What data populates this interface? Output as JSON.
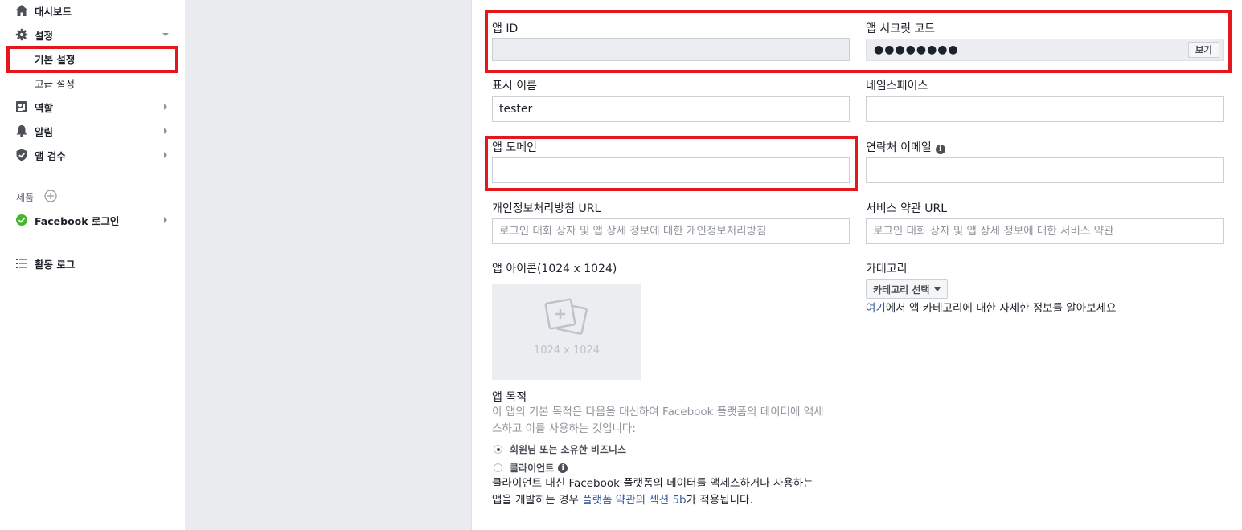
{
  "sidebar": {
    "items": [
      {
        "label": "대시보드",
        "icon": "home-icon"
      },
      {
        "label": "설정",
        "icon": "gear-icon"
      },
      {
        "label": "기본 설정"
      },
      {
        "label": "고급 설정"
      },
      {
        "label": "역할",
        "icon": "roles-icon"
      },
      {
        "label": "알림",
        "icon": "bell-icon"
      },
      {
        "label": "앱 검수",
        "icon": "shield-icon"
      }
    ],
    "products_label": "제품",
    "facebook_login": "Facebook 로그인",
    "activity_log": "활동 로그"
  },
  "form": {
    "app_id": {
      "label": "앱 ID",
      "value": ""
    },
    "app_secret": {
      "label": "앱 시크릿 코드",
      "masked": "●●●●●●●●",
      "show_button": "보기"
    },
    "display_name": {
      "label": "표시 이름",
      "value": "tester"
    },
    "namespace": {
      "label": "네임스페이스",
      "value": ""
    },
    "app_domain": {
      "label": "앱 도메인",
      "value": ""
    },
    "contact_email": {
      "label": "연락처 이메일",
      "value": ""
    },
    "privacy_url": {
      "label": "개인정보처리방침 URL",
      "placeholder": "로그인 대화 상자 및 앱 상세 정보에 대한 개인정보처리방침"
    },
    "terms_url": {
      "label": "서비스 약관 URL",
      "placeholder": "로그인 대화 상자 및 앱 상세 정보에 대한 서비스 약관"
    },
    "app_icon": {
      "label": "앱 아이콘(1024 x 1024)",
      "size_text": "1024 x 1024"
    },
    "category": {
      "label": "카테고리",
      "button": "카테고리 선택",
      "help_link": "여기",
      "help_rest": "에서 앱 카테고리에 대한 자세한 정보를 알아보세요"
    },
    "app_purpose": {
      "label": "앱 목적",
      "desc_line1": "이 앱의 기본 목적은 다음을 대신하여 Facebook 플랫폼의 데이터에 액세",
      "desc_line2": "스하고 이를 사용하는 것입니다:",
      "option_1": "회원님 또는 소유한 비즈니스",
      "option_2": "클라이언트",
      "note_line1": "클라이언트 대신 Facebook 플랫폼의 데이터를 액세스하거나 사용하는",
      "note_line2_pre": "앱을 개발하는 경우 ",
      "note_link": "플랫폼 약관의 섹션 5b",
      "note_line2_post": "가 적용됩니다."
    }
  },
  "colors": {
    "highlight": "#e4171c",
    "link": "#365899",
    "check": "#42b72a"
  }
}
